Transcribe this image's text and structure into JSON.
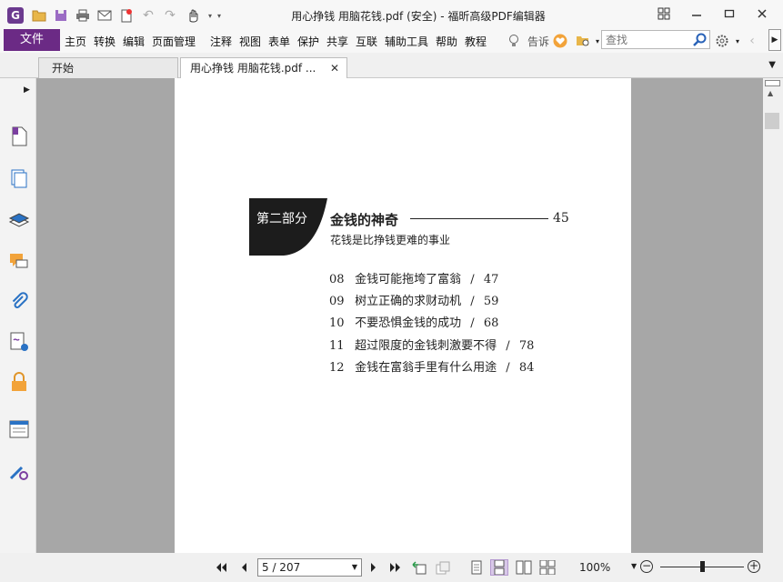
{
  "window": {
    "title": "用心挣钱 用脑花钱.pdf (安全) - 福昕高级PDF编辑器",
    "logo": "G"
  },
  "quick_access": [
    "open-folder-icon",
    "save-icon",
    "print-icon",
    "email-icon",
    "new-icon",
    "undo-icon",
    "redo-icon",
    "hand-tool-icon",
    "customize-icon"
  ],
  "window_controls": [
    "layout-icon",
    "minimize-icon",
    "restore-icon",
    "close-icon"
  ],
  "menu": {
    "file": "文件",
    "items": [
      "主页",
      "转换",
      "编辑",
      "页面管理",
      "注释",
      "视图",
      "表单",
      "保护",
      "共享",
      "互联",
      "辅助工具",
      "帮助",
      "教程"
    ],
    "tell_me": "告诉",
    "search_placeholder": "查找"
  },
  "tabs": [
    {
      "label": "开始"
    },
    {
      "label": "用心挣钱 用脑花钱.pdf ...",
      "active": true
    }
  ],
  "sidebar_icons": [
    "page-thumbnail-icon",
    "pages-icon",
    "layers-icon",
    "comments-icon",
    "attachments-icon",
    "signature-icon",
    "security-lock-icon",
    "form-fields-icon",
    "certificate-icon"
  ],
  "document": {
    "part_label": "第二部分",
    "part_title": "金钱的神奇",
    "part_page": "45",
    "part_subtitle": "花钱是比挣钱更难的事业",
    "toc": [
      {
        "num": "08",
        "title": "金钱可能拖垮了富翁",
        "sep": "/",
        "page": "47"
      },
      {
        "num": "09",
        "title": "树立正确的求财动机",
        "sep": "/",
        "page": "59"
      },
      {
        "num": "10",
        "title": "不要恐惧金钱的成功",
        "sep": "/",
        "page": "68"
      },
      {
        "num": "11",
        "title": "超过限度的金钱刺激要不得",
        "sep": "/",
        "page": "78"
      },
      {
        "num": "12",
        "title": "金钱在富翁手里有什么用途",
        "sep": "/",
        "page": "84"
      }
    ]
  },
  "status": {
    "page_indicator": "5 / 207",
    "zoom": "100%",
    "zoom_level": 0.5
  },
  "colors": {
    "brand": "#6b2a85",
    "doc_background": "#a7a7a7"
  }
}
